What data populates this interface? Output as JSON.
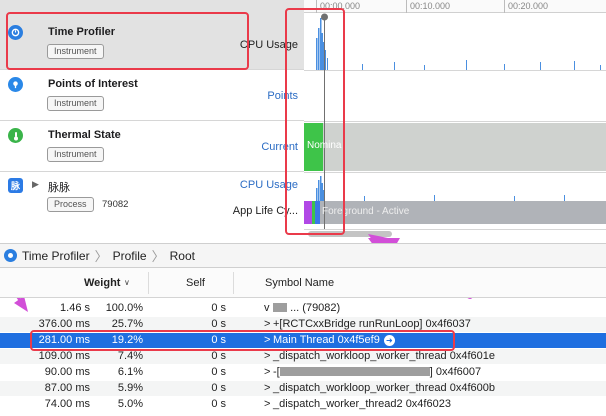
{
  "timeline": {
    "ruler_ticks": [
      "00:00.000",
      "00:10.000",
      "00:20.000"
    ]
  },
  "lanes": [
    {
      "icon": "time-profiler-icon",
      "title": "Time Profiler",
      "badge": "Instrument",
      "tracks": [
        "CPU Usage"
      ]
    },
    {
      "icon": "points-of-interest-icon",
      "title": "Points of Interest",
      "badge": "Instrument",
      "tracks": [
        "Points"
      ]
    },
    {
      "icon": "thermal-state-icon",
      "title": "Thermal State",
      "badge": "Instrument",
      "tracks": [
        "Current"
      ],
      "graph_text": "Nomina"
    },
    {
      "icon_text": "脉",
      "title": "脉脉",
      "badge": "Process",
      "pid": "79082",
      "tracks": [
        "CPU Usage",
        "App Life Cy..."
      ],
      "graph_text": "Foreground - Active"
    }
  ],
  "breadcrumb": [
    "Time Profiler",
    "Profile",
    "Root"
  ],
  "calltree": {
    "headers": {
      "weight": "Weight",
      "self": "Self",
      "symbol": "Symbol Name"
    },
    "rows": [
      {
        "ms": "1.46 s",
        "pct": "100.0%",
        "self": "0 s",
        "symbol": "... (79082)",
        "disclosure": "v"
      },
      {
        "ms": "376.00 ms",
        "pct": "25.7%",
        "self": "0 s",
        "symbol": "+[RCTCxxBridge runRunLoop]  0x4f6037",
        "disclosure": ">"
      },
      {
        "ms": "281.00 ms",
        "pct": "19.2%",
        "self": "0 s",
        "symbol": "Main Thread  0x4f5ef9",
        "disclosure": ">",
        "selected": true
      },
      {
        "ms": "109.00 ms",
        "pct": "7.4%",
        "self": "0 s",
        "symbol": "_dispatch_workloop_worker_thread  0x4f601e",
        "disclosure": ">"
      },
      {
        "ms": "90.00 ms",
        "pct": "6.1%",
        "self": "0 s",
        "symbol_prefix": "-[",
        "symbol": "]  0x4f6007",
        "disclosure": ">"
      },
      {
        "ms": "87.00 ms",
        "pct": "5.9%",
        "self": "0 s",
        "symbol": "_dispatch_workloop_worker_thread  0x4f600b",
        "disclosure": ">"
      },
      {
        "ms": "74.00 ms",
        "pct": "5.0%",
        "self": "0 s",
        "symbol": "_dispatch_worker_thread2  0x4f6023",
        "disclosure": ">"
      }
    ]
  },
  "colors": {
    "accent": "#1f6fe0",
    "annotation_red": "#ea3a4a",
    "annotation_magenta": "#d24fd8",
    "cpu_graph": "#4a8fe0",
    "thermal_green": "#3ec449",
    "lifecycle_gray": "#b0b3b8"
  }
}
